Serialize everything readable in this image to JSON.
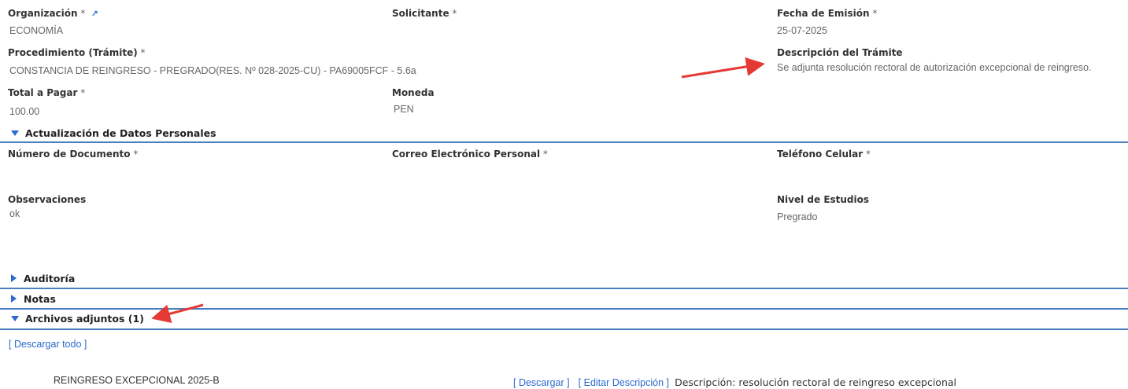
{
  "fields": {
    "organizacion": {
      "label": "Organización",
      "req": " *",
      "value": "ECONOMÍA",
      "link_icon": "external-link-icon",
      "link_glyph": "↗"
    },
    "solicitante": {
      "label": "Solicitante",
      "req": " *"
    },
    "fecha_emision": {
      "label": "Fecha de Emisión",
      "req": " *",
      "value": "25-07-2025"
    },
    "procedimiento": {
      "label": "Procedimiento (Trámite)",
      "req": " *",
      "value": "CONSTANCIA DE REINGRESO - PREGRADO(RES. Nº 028-2025-CU) - PA69005FCF - 5.6a"
    },
    "descripcion_tramite": {
      "label": "Descripción del Trámite",
      "value": "Se adjunta resolución rectoral de autorización excepcional de reingreso."
    },
    "total_pagar": {
      "label": "Total a Pagar",
      "req": " *",
      "value": "100.00"
    },
    "moneda": {
      "label": "Moneda",
      "value": "PEN"
    }
  },
  "sections": {
    "datos_personales": {
      "title": "Actualización de Datos Personales",
      "numero_documento": {
        "label": "Número de Documento",
        "req": " *"
      },
      "correo": {
        "label": "Correo Electrónico Personal",
        "req": " *"
      },
      "telefono": {
        "label": "Teléfono Celular",
        "req": " *"
      },
      "observaciones": {
        "label": "Observaciones",
        "value": "ok"
      },
      "nivel_estudios": {
        "label": "Nivel de Estudios",
        "value": "Pregrado"
      }
    },
    "auditoria": {
      "title": "Auditoría"
    },
    "notas": {
      "title": "Notas"
    },
    "archivos": {
      "title": "Archivos adjuntos (1)",
      "download_all": "[ Descargar todo ]",
      "files": [
        {
          "name": "REINGRESO EXCEPCIONAL 2025-B",
          "download": "[ Descargar ]",
          "edit": "[ Editar Descripción ]",
          "description": "Descripción: resolución rectoral de reingreso excepcional"
        }
      ]
    }
  },
  "colors": {
    "accent": "#2a6ad0",
    "rule": "#4a7fc0",
    "annotation_arrow": "#e53935"
  }
}
